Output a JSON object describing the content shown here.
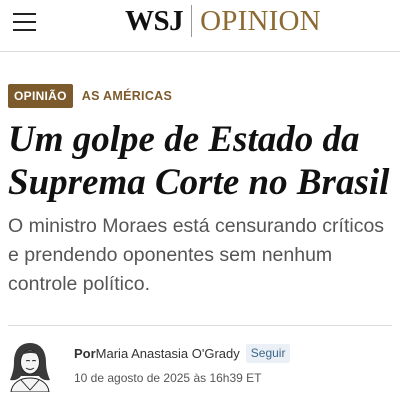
{
  "header": {
    "logo_wsj": "WSJ",
    "logo_section": "OPINION",
    "menu_icon": "hamburger-menu-icon"
  },
  "article": {
    "badge": "OPINIÃO",
    "column": "AS AMÉRICAS",
    "headline": "Um golpe de Estado da Suprema Corte no Brasil",
    "dek": "O ministro Moraes está censurando críticos e prendendo oponentes sem nenhum controle político.",
    "byline_prefix": "Por",
    "author": "Maria Anastasia O'Grady",
    "follow_label": "Seguir",
    "timestamp": "10 de agosto de 2025 às 16h39 ET"
  },
  "colors": {
    "accent_brown": "#7d5a2b",
    "logo_opinion": "#8c6a34",
    "follow_bg": "#eaf0f6",
    "follow_text": "#3d6689"
  }
}
